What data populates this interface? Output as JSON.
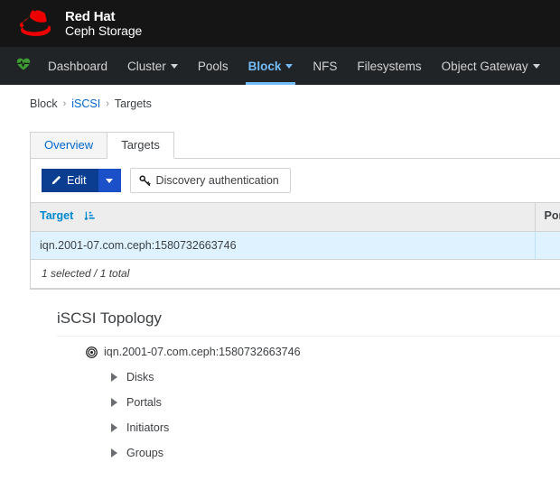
{
  "masthead": {
    "brand_top": "Red Hat",
    "brand_bottom": "Ceph Storage",
    "logo_icon": "red-hat-fedora-logo"
  },
  "topnav": {
    "health_icon": "heartbeat-icon",
    "items": [
      {
        "label": "Dashboard",
        "has_caret": false,
        "active": false
      },
      {
        "label": "Cluster",
        "has_caret": true,
        "active": false
      },
      {
        "label": "Pools",
        "has_caret": false,
        "active": false
      },
      {
        "label": "Block",
        "has_caret": true,
        "active": true
      },
      {
        "label": "NFS",
        "has_caret": false,
        "active": false
      },
      {
        "label": "Filesystems",
        "has_caret": false,
        "active": false
      },
      {
        "label": "Object Gateway",
        "has_caret": true,
        "active": false
      }
    ],
    "accent_color": "#73bcf7",
    "background_color": "#212427"
  },
  "breadcrumb": {
    "items": [
      {
        "label": "Block",
        "link": false
      },
      {
        "label": "iSCSI",
        "link": true
      },
      {
        "label": "Targets",
        "link": false
      }
    ],
    "separator": "›"
  },
  "tabs": [
    {
      "label": "Overview",
      "active": false
    },
    {
      "label": "Targets",
      "active": true
    }
  ],
  "toolbar": {
    "edit_label": "Edit",
    "edit_icon": "pencil-icon",
    "dropdown_icon": "chevron-down-icon",
    "discovery_label": "Discovery authentication",
    "discovery_icon": "key-icon"
  },
  "table": {
    "columns": [
      {
        "key": "target",
        "label": "Target",
        "sorted": true,
        "sort_icon": "sort-amount-down-icon"
      },
      {
        "key": "portals",
        "label": "Portals",
        "sorted": false,
        "sort_icon": "sort-icon"
      }
    ],
    "rows": [
      {
        "target": "iqn.2001-07.com.ceph:1580732663746",
        "portals": "",
        "selected": true
      }
    ],
    "footer": "1 selected / 1 total",
    "selected_row_color": "#def3ff"
  },
  "topology": {
    "title": "iSCSI Topology",
    "root": {
      "label": "iqn.2001-07.com.ceph:1580732663746",
      "icon": "bullseye-icon"
    },
    "children": [
      {
        "label": "Disks",
        "expanded": false,
        "icon": "caret-right-icon"
      },
      {
        "label": "Portals",
        "expanded": false,
        "icon": "caret-right-icon"
      },
      {
        "label": "Initiators",
        "expanded": false,
        "icon": "caret-right-icon"
      },
      {
        "label": "Groups",
        "expanded": false,
        "icon": "caret-right-icon"
      }
    ]
  }
}
